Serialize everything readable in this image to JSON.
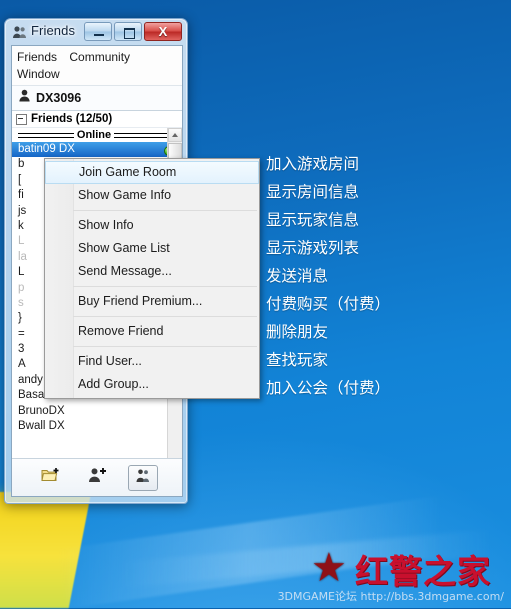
{
  "window": {
    "title": "Friends",
    "icon": "friends-icon",
    "buttons": {
      "minimize": "—",
      "maximize": "□",
      "close": "X"
    }
  },
  "menubar": {
    "items": [
      "Friends",
      "Community",
      "Window"
    ]
  },
  "user": {
    "name": "DX3096",
    "icon": "user-icon"
  },
  "group": {
    "label": "Friends (12/50)",
    "expander": "collapse-icon"
  },
  "list": {
    "divider_label": "Online",
    "selected": "batin09 DX",
    "items": [
      "batin09 DX",
      "b",
      "[",
      "fi",
      "js",
      "k",
      "L",
      "la",
      "L",
      "p",
      "s",
      "}",
      "=",
      "3",
      "A",
      "andy C上海电?M",
      "Basara DX",
      "BrunoDX",
      "Bwall DX"
    ],
    "visible_tail": [
      "andy C上海电?M",
      "Basara DX",
      "BrunoDX",
      "Bwall DX"
    ]
  },
  "context_menu": {
    "items": [
      {
        "label": "Join Game Room",
        "highlighted": true
      },
      {
        "label": "Show Game Info",
        "highlighted": false
      },
      {
        "separator": true
      },
      {
        "label": "Show Info",
        "highlighted": false
      },
      {
        "label": "Show Game List",
        "highlighted": false
      },
      {
        "label": "Send Message...",
        "highlighted": false
      },
      {
        "separator": true
      },
      {
        "label": "Buy Friend Premium...",
        "highlighted": false
      },
      {
        "separator": true
      },
      {
        "label": "Remove Friend",
        "highlighted": false
      },
      {
        "separator": true
      },
      {
        "label": "Find User...",
        "highlighted": false
      },
      {
        "label": "Add Group...",
        "highlighted": false
      }
    ]
  },
  "toolbar": {
    "buttons": [
      {
        "name": "add-folder-icon",
        "framed": false
      },
      {
        "name": "add-user-icon",
        "framed": false
      },
      {
        "name": "friends-list-icon",
        "framed": true
      }
    ]
  },
  "annotations": [
    "加入游戏房间",
    "显示房间信息",
    "显示玩家信息",
    "显示游戏列表",
    "发送消息",
    "付费购买（付费）",
    "删除朋友",
    "查找玩家",
    "加入公会（付费）"
  ],
  "watermark": {
    "star": "★",
    "brand": "红警之家",
    "url": "3DMGAME论坛 http://bbs.3dmgame.com/"
  },
  "colors": {
    "desktop_blue": "#0e6cbd",
    "selection_blue": "#1565c6",
    "close_red": "#bb2a26",
    "online_green": "#2ea80e",
    "watermark_red": "#c8102e"
  }
}
